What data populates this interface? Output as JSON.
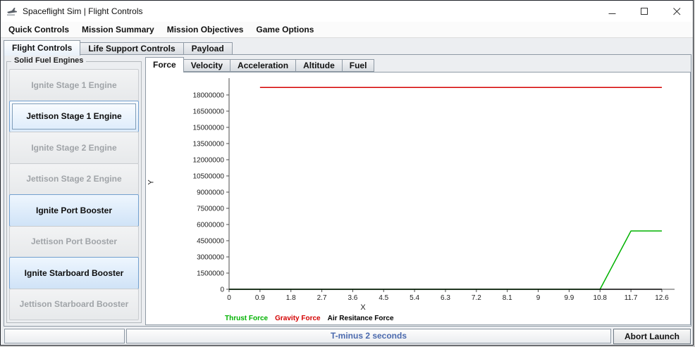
{
  "window": {
    "title": "Spaceflight Sim | Flight Controls"
  },
  "icons": {
    "app": "app-icon",
    "minimize": "minimize-icon",
    "maximize": "maximize-icon",
    "close": "close-icon"
  },
  "menu": {
    "items": [
      "Quick Controls",
      "Mission Summary",
      "Mission Objectives",
      "Game Options"
    ]
  },
  "main_tabs": [
    {
      "label": "Flight Controls",
      "selected": true
    },
    {
      "label": "Life Support Controls",
      "selected": false
    },
    {
      "label": "Payload",
      "selected": false
    }
  ],
  "engine_panel": {
    "title": "Solid Fuel Engines",
    "buttons": [
      {
        "label": "Ignite Stage 1 Engine",
        "enabled": false
      },
      {
        "label": "Jettison Stage 1 Engine",
        "enabled": true,
        "focused": true
      },
      {
        "label": "Ignite Stage 2 Engine",
        "enabled": false
      },
      {
        "label": "Jettison Stage 2 Engine",
        "enabled": false
      },
      {
        "label": "Ignite Port Booster",
        "enabled": true
      },
      {
        "label": "Jettison Port Booster",
        "enabled": false
      },
      {
        "label": "Ignite Starboard Booster",
        "enabled": true
      },
      {
        "label": "Jettison Starboard Booster",
        "enabled": false
      }
    ]
  },
  "chart_tabs": [
    {
      "label": "Force",
      "selected": true
    },
    {
      "label": "Velocity",
      "selected": false
    },
    {
      "label": "Acceleration",
      "selected": false
    },
    {
      "label": "Altitude",
      "selected": false
    },
    {
      "label": "Fuel",
      "selected": false
    }
  ],
  "chart_data": {
    "type": "line",
    "title": "",
    "xlabel": "X",
    "ylabel": "Y",
    "xlim": [
      0,
      12.97
    ],
    "ylim": [
      0,
      19560000
    ],
    "x_ticks": [
      0,
      0.9,
      1.8,
      2.7,
      3.6,
      4.5,
      5.4,
      6.3,
      7.2,
      8.1,
      9,
      9.9,
      10.8,
      11.7,
      12.6
    ],
    "y_ticks": [
      0,
      1500000,
      3000000,
      4500000,
      6000000,
      7500000,
      9000000,
      10500000,
      12000000,
      13500000,
      15000000,
      16500000,
      18000000
    ],
    "grid": false,
    "legend_position": "bottom",
    "series": [
      {
        "name": "Thrust Force",
        "color": "#00b200",
        "points": [
          [
            0,
            0
          ],
          [
            10.8,
            0
          ],
          [
            11.7,
            5400000
          ],
          [
            12.6,
            5400000
          ]
        ]
      },
      {
        "name": "Gravity Force",
        "color": "#d40000",
        "points": [
          [
            0.9,
            18700000
          ],
          [
            12.6,
            18700000
          ]
        ]
      },
      {
        "name": "Air Resitance Force",
        "color": "#000000",
        "points": [
          [
            0,
            0
          ],
          [
            12.6,
            0
          ]
        ]
      }
    ]
  },
  "status_bar": {
    "countdown": "T-minus 2 seconds",
    "abort_label": "Abort Launch"
  }
}
